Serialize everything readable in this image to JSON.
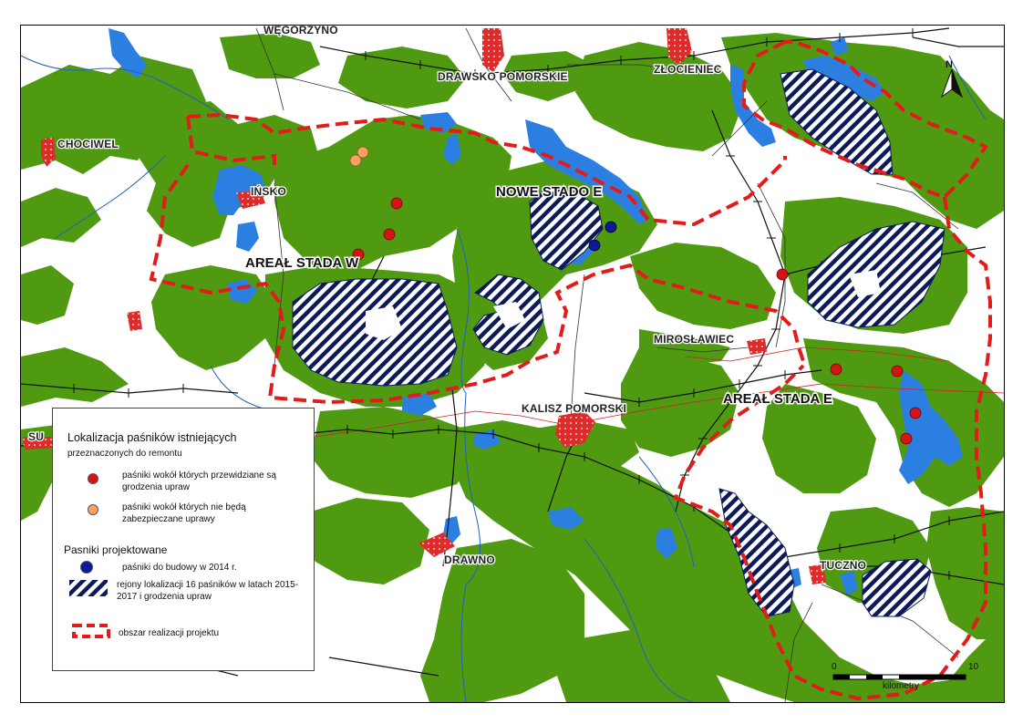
{
  "towns": {
    "wegorzyno": "WĘGORZYNO",
    "drawsko": "DRAWSKO POMORSKIE",
    "zlocieniec": "ZŁOCIENIEC",
    "chociwel": "CHOCIWEL",
    "insko": "IŃSKO",
    "miroslawiec": "MIROSŁAWIEC",
    "kalisz": "KALISZ POMORSKI",
    "drawno": "DRAWNO",
    "tuczno": "TUCZNO",
    "su": "SU"
  },
  "areas": {
    "nowe_stado": "NOWE STADO E",
    "areal_w": "AREAŁ STADA W",
    "areal_e": "AREAŁ STADA E"
  },
  "legend": {
    "title": "Lokalizacja paśników istniejących",
    "subtitle": "przeznaczonych do remontu",
    "item_red": "paśniki wokół których przewidziane są grodzenia upraw",
    "item_orange": "paśniki wokół których nie będą zabezpieczane uprawy",
    "section2": "Pasniki projektowane",
    "item_blue": "paśniki do budowy w 2014 r.",
    "item_hatch": "rejony lokalizacji 16 paśników w latach 2015-2017 i grodzenia upraw",
    "item_boundary": "obszar realizacji projektu"
  },
  "scale": {
    "left": "0",
    "right": "10",
    "unit": "kilometry"
  },
  "north": "N",
  "colors": {
    "forest": "#4f9a11",
    "water": "#2b7fe0",
    "town": "#e02b2b",
    "boundary": "#e21b1b",
    "hatch": "#0d1a5a",
    "red_marker": "#d41414",
    "orange_marker": "#f5a463",
    "blue_marker": "#0a1a9a"
  }
}
